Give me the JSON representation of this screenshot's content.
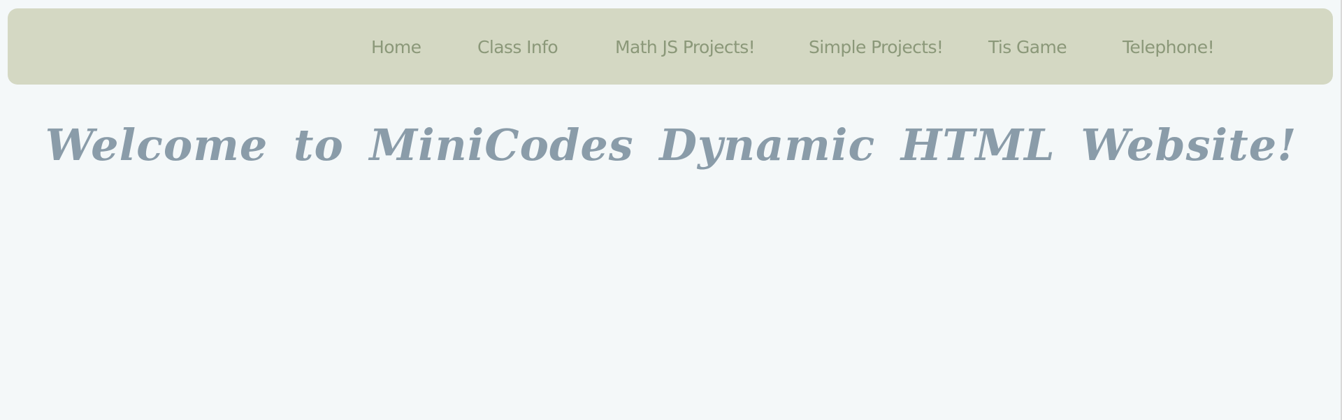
{
  "nav": {
    "items": [
      {
        "label": "Home"
      },
      {
        "label": "Class Info"
      },
      {
        "label": "Math JS Projects!"
      },
      {
        "label": "Simple Projects!"
      },
      {
        "label": "Tis Game"
      },
      {
        "label": "Telephone!"
      }
    ]
  },
  "main": {
    "title": "Welcome to MiniCodes Dynamic HTML Website!"
  },
  "colors": {
    "page_background": "#f4f8f9",
    "navbar_background": "#d4d8c3",
    "nav_text": "#8b9879",
    "title_text": "#8a9ca9"
  }
}
